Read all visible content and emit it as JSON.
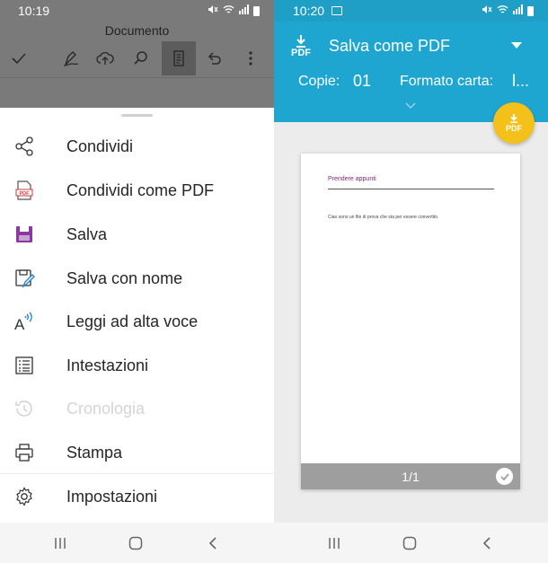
{
  "left": {
    "status": {
      "time": "10:19"
    },
    "document_title": "Documento",
    "toolbar_icons": [
      "check-icon",
      "pen-icon",
      "cloud-upload-icon",
      "search-icon",
      "document-view-icon",
      "undo-icon",
      "more-vertical-icon"
    ],
    "menu": [
      {
        "icon": "share-icon",
        "label": "Condividi",
        "enabled": true
      },
      {
        "icon": "share-pdf-icon",
        "label": "Condividi come PDF",
        "enabled": true
      },
      {
        "icon": "save-icon",
        "label": "Salva",
        "enabled": true
      },
      {
        "icon": "save-as-icon",
        "label": "Salva con nome",
        "enabled": true
      },
      {
        "icon": "read-aloud-icon",
        "label": "Leggi ad alta voce",
        "enabled": true
      },
      {
        "icon": "headings-icon",
        "label": "Intestazioni",
        "enabled": true
      },
      {
        "icon": "history-icon",
        "label": "Cronologia",
        "enabled": false
      },
      {
        "icon": "print-icon",
        "label": "Stampa",
        "enabled": true
      },
      {
        "icon": "settings-icon",
        "label": "Impostazioni",
        "enabled": true
      }
    ]
  },
  "right": {
    "status": {
      "time": "10:20"
    },
    "printer": {
      "pdf_icon_label": "PDF",
      "name": "Salva come PDF",
      "copies_label": "Copie:",
      "copies_value": "01",
      "paper_label": "Formato carta:",
      "paper_value": "l..."
    },
    "fab_label": "PDF",
    "preview": {
      "heading": "Prendere appunti",
      "body": "Ciao sono un file di prova che sta per essere convertito.",
      "page_counter": "1/1"
    }
  },
  "colors": {
    "header_blue": "#1fa6d0",
    "status_blue": "#1f9ec6",
    "fab_yellow": "#f4c11a",
    "save_purple": "#8a3a9e",
    "pdf_red": "#d23b3b",
    "heading_purple": "#7a2a6e"
  }
}
